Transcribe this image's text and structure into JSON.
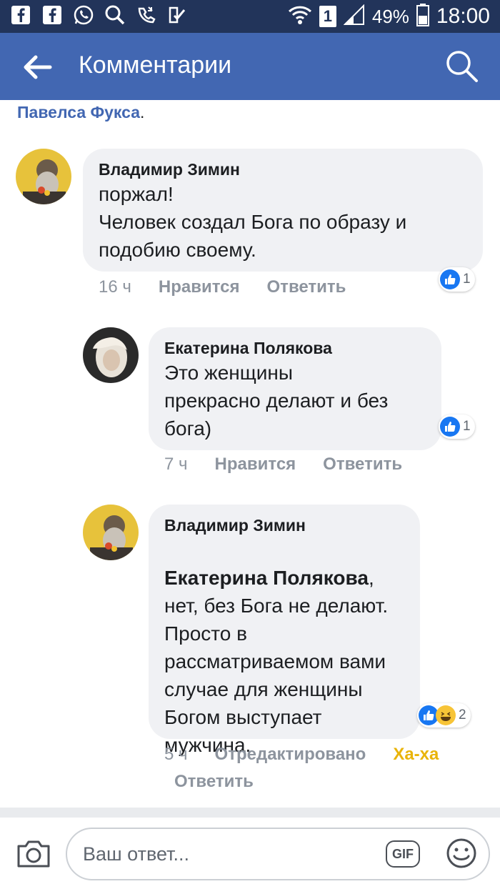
{
  "status_bar": {
    "battery_percent": "49%",
    "time": "18:00",
    "sim_label": "1"
  },
  "app_bar": {
    "title": "Комментарии"
  },
  "previous": {
    "name": "Павелса Фукса",
    "trailing": "."
  },
  "comments": [
    {
      "author": "Владимир Зимин",
      "text": "поржал!\nЧеловек создал Бога по образу и подобию своему.",
      "time": "16 ч",
      "like_label": "Нравится",
      "reply_label": "Ответить",
      "reaction_count": "1"
    },
    {
      "author": "Екатерина Полякова",
      "text": "Это женщины\nпрекрасно делают и без бога)",
      "time": "7 ч",
      "like_label": "Нравится",
      "reply_label": "Ответить",
      "reaction_count": "1"
    },
    {
      "author": "Владимир Зимин",
      "mention": "Екатерина Полякова",
      "mention_trailing": ",",
      "text": "нет, без Бога не делают. Просто в рассматриваемом вами случае для женщины Богом выступает мужчина.",
      "time": "5 ч",
      "edited_label": "Отредактировано",
      "haha_label": "Ха-ха",
      "reply_label": "Ответить",
      "reaction_count": "2"
    }
  ],
  "composer": {
    "placeholder": "Ваш ответ...",
    "gif_label": "GIF"
  },
  "colors": {
    "status_bar": "#22345a",
    "app_bar": "#4267b2",
    "bubble": "#f0f1f4",
    "link": "#4267b2",
    "meta": "#8d949e",
    "haha": "#e9b40a"
  }
}
